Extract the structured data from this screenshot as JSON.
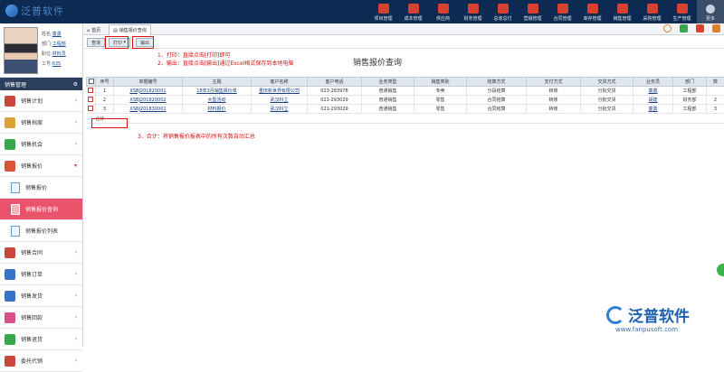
{
  "app": {
    "logo_text": "泛普软件"
  },
  "modules": [
    {
      "label": "项目管理",
      "color": "#d8412f"
    },
    {
      "label": "成本管理",
      "color": "#d8412f"
    },
    {
      "label": "供应商",
      "color": "#d8412f"
    },
    {
      "label": "财务管理",
      "color": "#d8412f"
    },
    {
      "label": "总收总付",
      "color": "#d8412f"
    },
    {
      "label": "营销管理",
      "color": "#d8412f"
    },
    {
      "label": "合同管理",
      "color": "#d8412f"
    },
    {
      "label": "库存管理",
      "color": "#d8412f"
    },
    {
      "label": "销售管理",
      "color": "#d8412f"
    },
    {
      "label": "采购管理",
      "color": "#d8412f"
    },
    {
      "label": "生产管理",
      "color": "#d8412f"
    },
    {
      "label": "更多",
      "color": "#c8d2de"
    }
  ],
  "user": {
    "name_label": "姓名:",
    "name": "童勇",
    "dept_label": "部门:",
    "dept": "工程部",
    "post_label": "职位:",
    "post": "材料员",
    "id_label": "工号:",
    "id": "635"
  },
  "sidebar": {
    "header": "销售管理",
    "items": [
      {
        "label": "销售计划",
        "icon": "chart-icon",
        "color": "#c9463b"
      },
      {
        "label": "销售档案",
        "icon": "archive-icon",
        "color": "#d9a23a"
      },
      {
        "label": "销售机会",
        "icon": "target-icon",
        "color": "#3aa84a"
      },
      {
        "label": "销售报价",
        "icon": "quote-icon",
        "color": "#d9563b"
      }
    ],
    "sub_items": [
      "销售报价",
      "销售报价查询",
      "销售报价列表"
    ],
    "items2": [
      {
        "label": "销售合同",
        "icon": "contract-icon",
        "color": "#c9463b"
      },
      {
        "label": "销售订单",
        "icon": "order-icon",
        "color": "#3a74c9"
      },
      {
        "label": "销售发货",
        "icon": "plane-icon",
        "color": "#3a74c9"
      },
      {
        "label": "销售回款",
        "icon": "money-icon",
        "color": "#d94f8a"
      },
      {
        "label": "销售退货",
        "icon": "return-icon",
        "color": "#3aa84a"
      },
      {
        "label": "委托代销",
        "icon": "consign-icon",
        "color": "#c9463b"
      }
    ]
  },
  "tabs": {
    "home": "首页",
    "active": "销售报价查询"
  },
  "toolbar": {
    "query": "查询",
    "print": "打印",
    "export": "输出"
  },
  "annotations": {
    "a1": "1、打印：直接点击[打印]即可",
    "a2": "2、输出：直接点击[输出]通过Excel格式保存到本地电脑",
    "a3": "3、合计：将销售报价报表中的所有次数自动汇总"
  },
  "page_title": "销售报价查询",
  "table": {
    "headers": [
      "序号",
      "单据编号",
      "主题",
      "客户名称",
      "客户电话",
      "业务类型",
      "销售类别",
      "结算方式",
      "支付方式",
      "交货方式",
      "业务员",
      "部门",
      "数"
    ],
    "rows": [
      [
        "1",
        "XSBJ201820001",
        "18年3月销售报价单",
        "重庆新世界有限公司",
        "023-283978",
        "普通销售",
        "专卖",
        "分段结算",
        "转账",
        "分批交货",
        "童勇",
        "工程部",
        ""
      ],
      [
        "2",
        "XSBJ201820002",
        "大型活动",
        "武汉科立",
        "021-293029",
        "普通销售",
        "零售",
        "合同结算",
        "转账",
        "分批交货",
        "胡建",
        "财务部",
        "2"
      ],
      [
        "3",
        "XSBJ201830001",
        "材料报价",
        "武汉科立",
        "021-293029",
        "普通销售",
        "零售",
        "合同结算",
        "转账",
        "分批交货",
        "童勇",
        "工程部",
        "3"
      ]
    ],
    "summary_label": "合计"
  },
  "watermark": {
    "brand": "泛普软件",
    "url": "www.fanpusoft.com"
  }
}
